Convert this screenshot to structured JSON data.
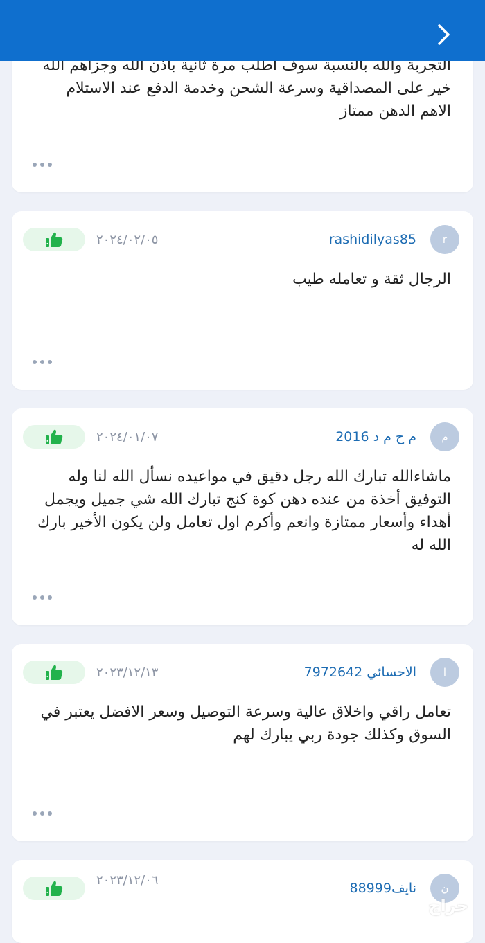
{
  "reviews": [
    {
      "text": "التجربة والله بالنسبة سوف اطلب مرة ثانية باذن الله وجزاهم الله خير على المصداقية وسرعة الشحن وخدمة الدفع عند الاستلام الاهم الدهن ممتاز"
    },
    {
      "avatar": "r",
      "username": "rashidilyas85",
      "date": "٢٠٢٤/٠٢/٠٥",
      "text": "الرجال ثقة و تعامله طيب"
    },
    {
      "avatar": "م",
      "username": "م ح م د 2016",
      "date": "٢٠٢٤/٠١/٠٧",
      "text": "ماشاءالله تبارك الله رجل دقيق في مواعيده نسأل الله لنا وله التوفيق أخذة من عنده دهن كوة كنج تبارك الله شي جميل ويجمل أهداء وأسعار ممتازة وانعم وأكرم اول تعامل ولن يكون الأخير بارك الله له"
    },
    {
      "avatar": "ا",
      "username": "الاحسائي 7972642",
      "date": "٢٠٢٣/١٢/١٣",
      "text": "تعامل راقي واخلاق عالية وسرعة التوصيل وسعر الافضل يعتبر في السوق وكذلك جودة ربي يبارك لهم"
    },
    {
      "avatar": "ن",
      "username": "نايف88999",
      "date": "٢٠٢٣/١٢/٠٦"
    }
  ],
  "watermark": "حراج",
  "colors": {
    "header": "#0f6fce",
    "like_bg": "#e6f7ea",
    "like_icon": "#22b24c",
    "username": "#1d6cb3"
  },
  "icons": {
    "back": "chevron-right-icon",
    "like": "thumbs-up-icon",
    "more": "more-dots-icon"
  }
}
